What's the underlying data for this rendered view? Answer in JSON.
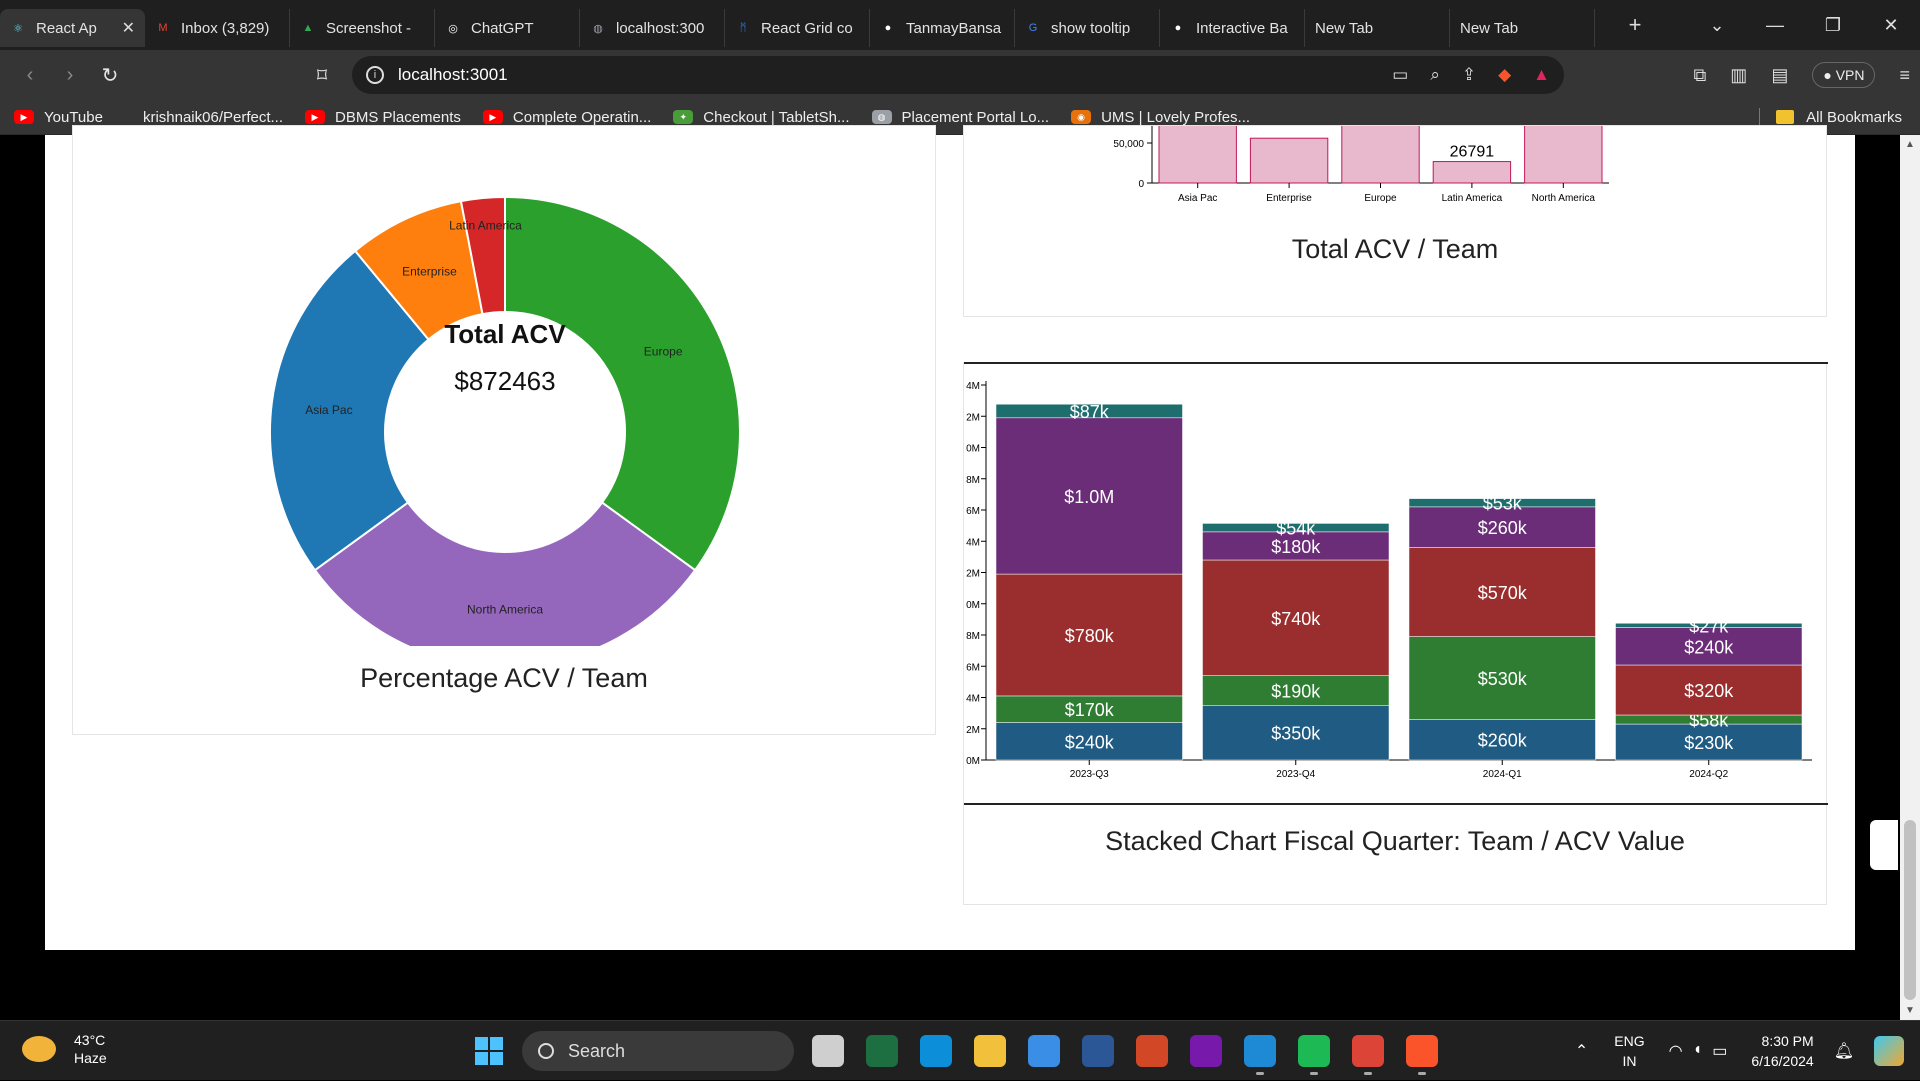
{
  "browser": {
    "tabs": [
      {
        "title": "React Ap",
        "color": "#61dafb",
        "glyph": "⚛",
        "active": true
      },
      {
        "title": "Inbox (3,829)",
        "color": "#ea4335",
        "glyph": "M"
      },
      {
        "title": "Screenshot -",
        "color": "#34a853",
        "glyph": "▲"
      },
      {
        "title": "ChatGPT",
        "color": "#ffffff",
        "glyph": "◎"
      },
      {
        "title": "localhost:300",
        "color": "#9aa0a6",
        "glyph": "◍"
      },
      {
        "title": "React Grid co",
        "color": "#2f80ed",
        "glyph": "ᛗ"
      },
      {
        "title": "TanmayBansa",
        "color": "#ffffff",
        "glyph": "●"
      },
      {
        "title": "show tooltip",
        "color": "#4285f4",
        "glyph": "G"
      },
      {
        "title": "Interactive Ba",
        "color": "#ffffff",
        "glyph": "●"
      },
      {
        "title": "New Tab",
        "color": "",
        "glyph": ""
      },
      {
        "title": "New Tab",
        "color": "",
        "glyph": ""
      }
    ],
    "new_tab_glyph": "+",
    "tab_search_glyph": "⌄",
    "window_controls": {
      "minimize": "—",
      "restore": "❐",
      "close": "✕"
    },
    "url": "localhost:3001",
    "vpn_label": "VPN",
    "bookmarks": [
      {
        "label": "YouTube",
        "color": "#ff0000",
        "glyph": "▶"
      },
      {
        "label": "krishnaik06/Perfect...",
        "color": "",
        "glyph": ""
      },
      {
        "label": "DBMS Placements",
        "color": "#ff0000",
        "glyph": "▶"
      },
      {
        "label": "Complete Operatin...",
        "color": "#ff0000",
        "glyph": "▶"
      },
      {
        "label": "Checkout | TabletSh...",
        "color": "#4a9b3a",
        "glyph": "✦"
      },
      {
        "label": "Placement Portal Lo...",
        "color": "#9aa0a6",
        "glyph": "◍"
      },
      {
        "label": "UMS | Lovely Profes...",
        "color": "#e8710a",
        "glyph": "◉"
      }
    ],
    "all_bookmarks_label": "All Bookmarks"
  },
  "donut_card": {
    "center_title": "Total ACV",
    "center_value": "$872463",
    "title": "Percentage ACV / Team"
  },
  "bar_card": {
    "title": "Total ACV / Team",
    "value_label": "26791"
  },
  "stacked_card": {
    "title": "Stacked Chart Fiscal Quarter: Team / ACV Value"
  },
  "chart_data": [
    {
      "type": "pie",
      "title": "Percentage ACV / Team",
      "center_label": "Total ACV",
      "center_value": "$872463",
      "slices": [
        {
          "label": "Europe",
          "value": 0.35,
          "color": "#2ca02c"
        },
        {
          "label": "North America",
          "value": 0.3,
          "color": "#9467bd"
        },
        {
          "label": "Asia Pac",
          "value": 0.24,
          "color": "#1f77b4"
        },
        {
          "label": "Enterprise",
          "value": 0.08,
          "color": "#ff7f0e"
        },
        {
          "label": "Latin America",
          "value": 0.03,
          "color": "#d62728"
        }
      ]
    },
    {
      "type": "bar",
      "title": "Total ACV / Team",
      "categories": [
        "Asia Pac",
        "Enterprise",
        "Europe",
        "Latin America",
        "North America"
      ],
      "yticks": [
        "0",
        "50,000"
      ],
      "visible_ylim": [
        0,
        100000
      ],
      "values": [
        160000,
        56000,
        250000,
        26791,
        200000
      ],
      "value_label": "26791",
      "bar_fill": "#e8b9cd",
      "bar_stroke": "#c2185b"
    },
    {
      "type": "bar",
      "stacked": true,
      "title": "Stacked Chart Fiscal Quarter: Team / ACV Value",
      "categories": [
        "2023-Q3",
        "2023-Q4",
        "2024-Q1",
        "2024-Q2"
      ],
      "yticks": [
        "0M",
        "2M",
        "4M",
        "6M",
        "8M",
        "0M",
        "2M",
        "4M",
        "6M",
        "8M",
        "0M",
        "2M",
        "4M"
      ],
      "ylim": [
        0,
        2400000
      ],
      "series": [
        {
          "color": "#1f5b82",
          "values": [
            240000,
            350000,
            260000,
            230000
          ],
          "labels": [
            "$240k",
            "$350k",
            "$260k",
            "$230k"
          ]
        },
        {
          "color": "#2e7d32",
          "values": [
            170000,
            190000,
            530000,
            58000
          ],
          "labels": [
            "$170k",
            "$190k",
            "$530k",
            "$58k"
          ]
        },
        {
          "color": "#9a2d2d",
          "values": [
            780000,
            740000,
            570000,
            320000
          ],
          "labels": [
            "$780k",
            "$740k",
            "$570k",
            "$320k"
          ]
        },
        {
          "color": "#6b2d78",
          "values": [
            1000000,
            180000,
            260000,
            240000
          ],
          "labels": [
            "$1.0M",
            "$180k",
            "$260k",
            "$240k"
          ]
        },
        {
          "color": "#1f6e6e",
          "values": [
            87000,
            54000,
            53000,
            27000
          ],
          "labels": [
            "$87k",
            "$54k",
            "$53k",
            "$27k"
          ]
        }
      ]
    }
  ],
  "taskbar": {
    "temperature": "43°C",
    "weather": "Haze",
    "search_label": "Search",
    "lang_top": "ENG",
    "lang_bottom": "IN",
    "time": "8:30 PM",
    "date": "6/16/2024",
    "apps": [
      {
        "name": "task-view",
        "color": "#cfcfcf"
      },
      {
        "name": "excel",
        "color": "#1d6f42"
      },
      {
        "name": "edge",
        "color": "#0c8fd8"
      },
      {
        "name": "file-explorer",
        "color": "#f3c03c"
      },
      {
        "name": "mail",
        "color": "#3a8ee6"
      },
      {
        "name": "word",
        "color": "#2b5797"
      },
      {
        "name": "powerpoint",
        "color": "#d24726"
      },
      {
        "name": "onenote",
        "color": "#7719aa"
      },
      {
        "name": "vscode",
        "color": "#1e8ad6"
      },
      {
        "name": "spotify",
        "color": "#1db954"
      },
      {
        "name": "chrome",
        "color": "#db4437"
      },
      {
        "name": "brave",
        "color": "#fb542b"
      }
    ]
  }
}
